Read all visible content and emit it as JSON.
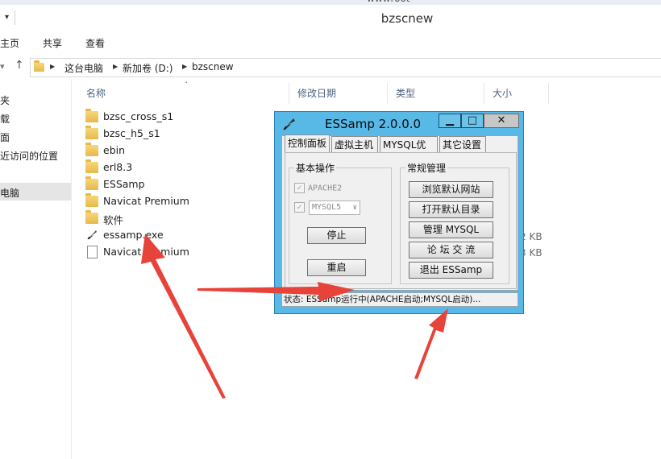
{
  "window": {
    "top_text": "wwwroot",
    "title": "bzscnew"
  },
  "ribbon": {
    "tabs": [
      "主页",
      "共享",
      "查看"
    ]
  },
  "address": {
    "crumbs": [
      "这台电脑",
      "新加卷 (D:)",
      "bzscnew"
    ]
  },
  "nav": {
    "items": [
      "夹",
      "载",
      "面",
      "近访问的位置",
      "电脑"
    ]
  },
  "columns": {
    "name": "名称",
    "modified": "修改日期",
    "type": "类型",
    "size": "大小"
  },
  "files": [
    {
      "name": "bzsc_cross_s1",
      "kind": "folder"
    },
    {
      "name": "bzsc_h5_s1",
      "kind": "folder"
    },
    {
      "name": "ebin",
      "kind": "folder"
    },
    {
      "name": "erl8.3",
      "kind": "folder"
    },
    {
      "name": "ESSamp",
      "kind": "folder"
    },
    {
      "name": "Navicat Premium",
      "kind": "folder"
    },
    {
      "name": "软件",
      "kind": "folder"
    },
    {
      "name": "essamp.exe",
      "kind": "exe",
      "size": "2 KB"
    },
    {
      "name": "Navicat Premium",
      "kind": "shortcut",
      "size": "3 KB"
    }
  ],
  "essamp": {
    "title": "ESSamp 2.0.0.0",
    "tabs": [
      "控制面板",
      "虚拟主机",
      "MYSQL优化",
      "其它设置"
    ],
    "basic_group": "基本操作",
    "manage_group": "常规管理",
    "apache_label": "APACHE2",
    "mysql_option": "MYSQL5",
    "stop_button": "停止",
    "restart_button": "重启",
    "browse_site_button": "浏览默认网站",
    "open_dir_button": "打开默认目录",
    "manage_mysql_button": "管理  MYSQL",
    "forum_button": "论 坛 交 流",
    "exit_button": "退出  ESSamp",
    "status": "状态: ESSamp运行中(APACHE启动;MYSQL启动)..."
  },
  "colors": {
    "dialog_blue": "#58b8e6",
    "arrow_red": "#e8433a"
  }
}
